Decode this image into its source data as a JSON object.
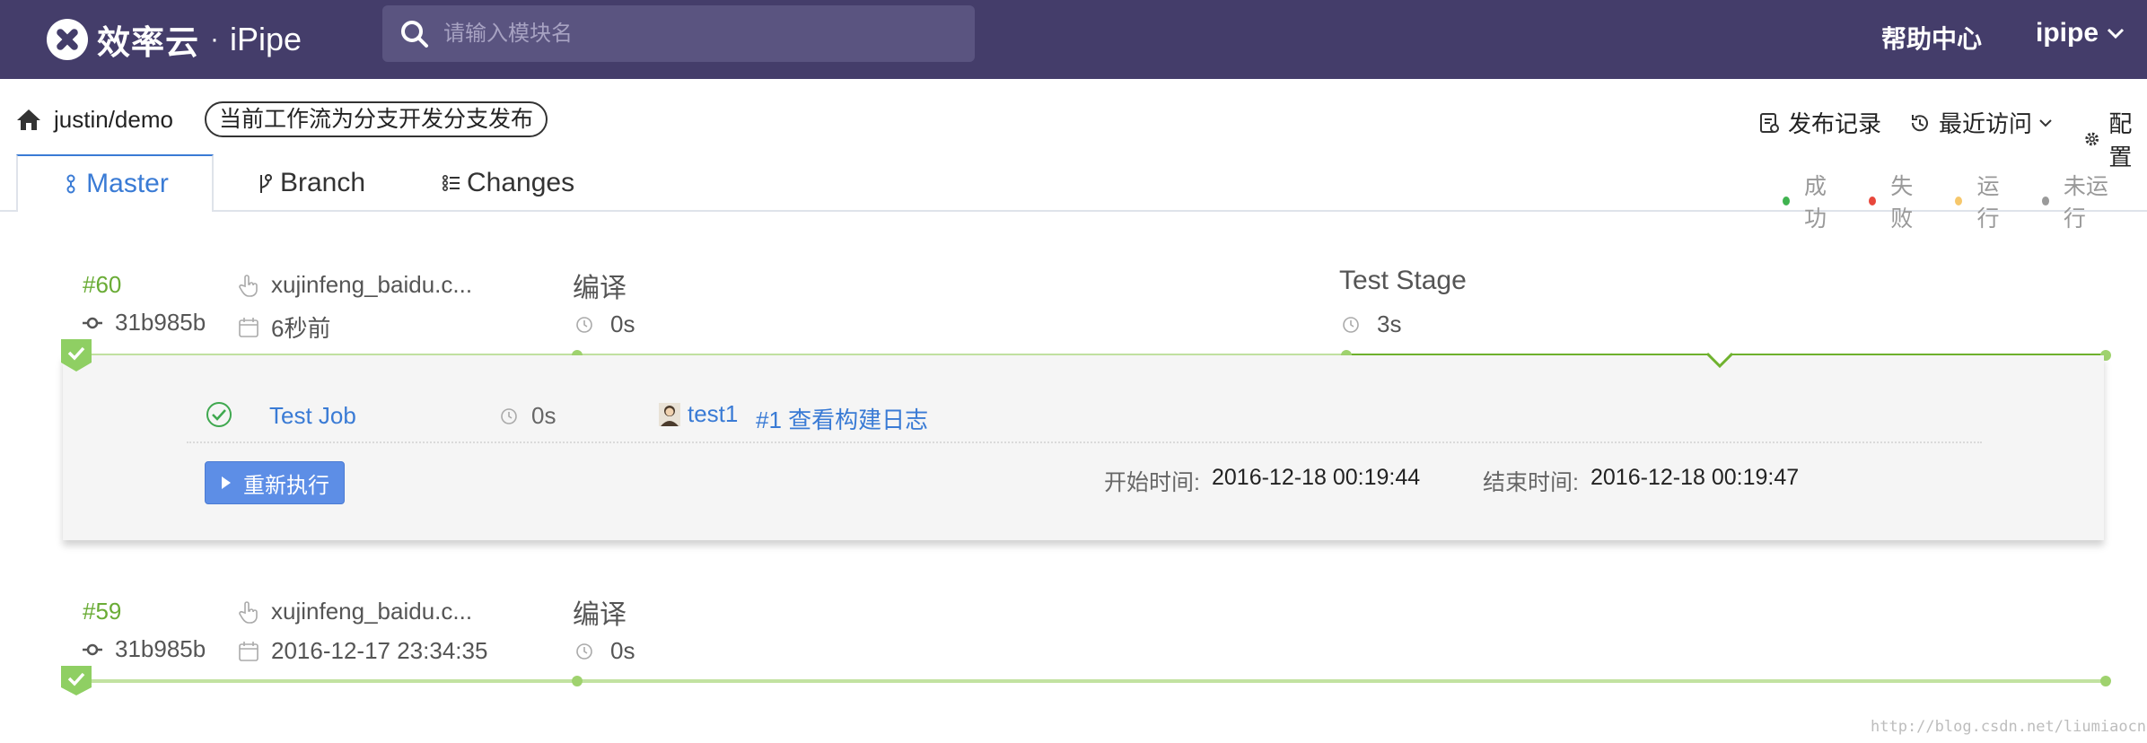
{
  "header": {
    "brand_name": "效率云",
    "brand_separator": "·",
    "brand_product": "iPipe",
    "search_placeholder": "请输入模块名",
    "help_label": "帮助中心",
    "user_label": "ipipe"
  },
  "subheader": {
    "project": "justin/demo",
    "workflow_badge": "当前工作流为分支开发分支发布",
    "links": {
      "release_records": "发布记录",
      "recent_visits": "最近访问",
      "settings": "配置"
    }
  },
  "tabs": [
    {
      "label": "Master",
      "icon": "branch-master-icon",
      "active": true
    },
    {
      "label": "Branch",
      "icon": "branch-icon",
      "active": false
    },
    {
      "label": "Changes",
      "icon": "list-icon",
      "active": false
    }
  ],
  "legend": [
    {
      "label": "成功",
      "color": "#3fb34f"
    },
    {
      "label": "失败",
      "color": "#e8473b"
    },
    {
      "label": "运行",
      "color": "#f6c76b"
    },
    {
      "label": "未运行",
      "color": "#9a9a9a"
    }
  ],
  "builds": [
    {
      "number": "#60",
      "commit": "31b985b",
      "trigger_user": "xujinfeng_baidu.c...",
      "time": "6秒前",
      "status": "success",
      "stages": [
        {
          "name": "编译",
          "duration": "0s"
        },
        {
          "name": "Test Stage",
          "duration": "3s"
        }
      ],
      "expanded": {
        "job_name": "Test Job",
        "job_duration": "0s",
        "job_user": "test1",
        "log_link": "#1 查看构建日志",
        "rerun_label": "重新执行",
        "start_label": "开始时间:",
        "start_time": "2016-12-18 00:19:44",
        "end_label": "结束时间:",
        "end_time": "2016-12-18 00:19:47"
      }
    },
    {
      "number": "#59",
      "commit": "31b985b",
      "trigger_user": "xujinfeng_baidu.c...",
      "time": "2016-12-17 23:34:35",
      "status": "success",
      "stages": [
        {
          "name": "编译",
          "duration": "0s"
        }
      ]
    }
  ],
  "watermark": "http://blog.csdn.net/liumiaocn",
  "colors": {
    "header_bg": "#443d6a",
    "success_green": "#6aac36",
    "link_blue": "#3a7bd5"
  }
}
